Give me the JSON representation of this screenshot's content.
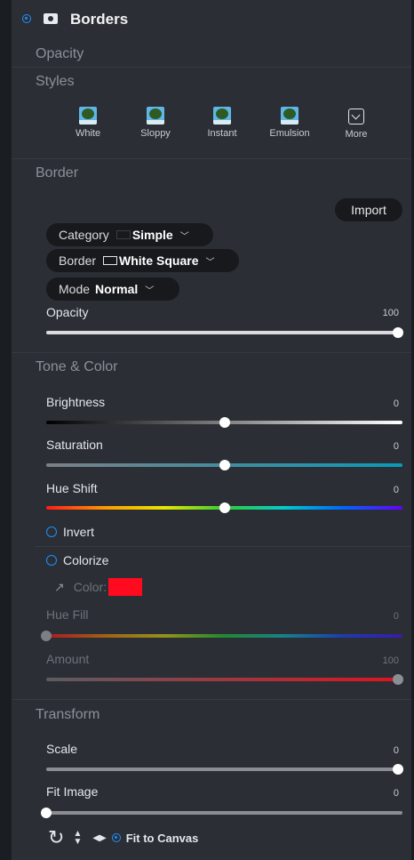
{
  "header": {
    "title": "Borders"
  },
  "sections": {
    "opacity": "Opacity",
    "styles": "Styles",
    "border": "Border",
    "tone_color": "Tone & Color",
    "transform": "Transform"
  },
  "styles_presets": [
    {
      "label": "White",
      "icon": "tree-thumbnail-icon"
    },
    {
      "label": "Sloppy",
      "icon": "tree-thumbnail-icon"
    },
    {
      "label": "Instant",
      "icon": "tree-thumbnail-icon"
    },
    {
      "label": "Emulsion",
      "icon": "tree-thumbnail-icon"
    },
    {
      "label": "More",
      "icon": "chevron-box-icon"
    }
  ],
  "border": {
    "import_label": "Import",
    "category_label": "Category",
    "category_value": "Simple",
    "border_label": "Border",
    "border_value": "White Square",
    "mode_label": "Mode",
    "mode_value": "Normal",
    "opacity_label": "Opacity",
    "opacity_value": "100",
    "opacity_level": 1.0
  },
  "tone": {
    "brightness_label": "Brightness",
    "brightness_value": "0",
    "brightness_level": 0.5,
    "saturation_label": "Saturation",
    "saturation_value": "0",
    "saturation_level": 0.5,
    "hue_shift_label": "Hue Shift",
    "hue_shift_value": "0",
    "hue_shift_level": 0.5,
    "invert_label": "Invert",
    "colorize_label": "Colorize",
    "color_label": "Color:",
    "color_value": "#ff0a1f",
    "hue_fill_label": "Hue Fill",
    "hue_fill_value": "0",
    "hue_fill_level": 0.0,
    "amount_label": "Amount",
    "amount_value": "100",
    "amount_level": 1.0
  },
  "transform": {
    "scale_label": "Scale",
    "scale_value": "0",
    "scale_level": 1.0,
    "fit_image_label": "Fit Image",
    "fit_image_value": "0",
    "fit_image_level": 0.0,
    "fit_to_canvas_label": "Fit to Canvas"
  },
  "colors": {
    "accent": "#1e8fff",
    "panel": "#2b2f35",
    "pill": "#17191c"
  }
}
